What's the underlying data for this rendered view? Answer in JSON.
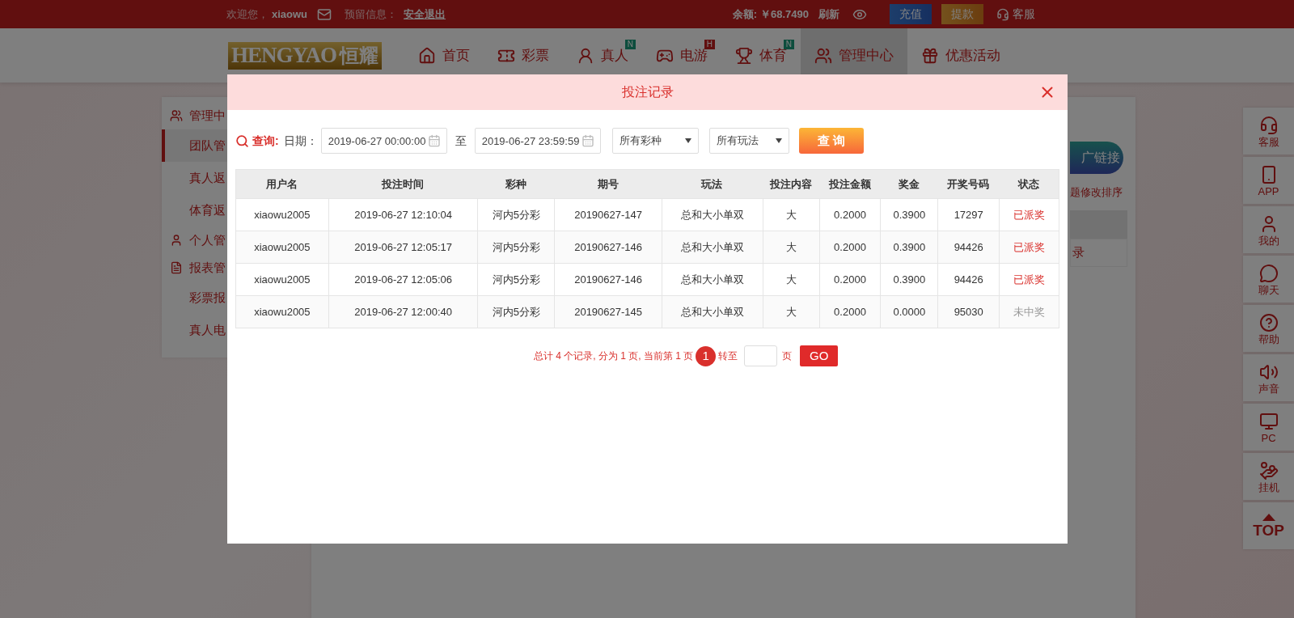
{
  "top_bar": {
    "welcome": "欢迎您，",
    "username": "xiaowu",
    "reserved_label": "预留信息：",
    "logout": "安全退出",
    "balance_label": "余额:",
    "balance": "￥68.7490",
    "refresh": "刷新",
    "deposit": "充值",
    "withdraw": "提款",
    "service": "客服"
  },
  "logo": {
    "latin": "HENGYAO",
    "chinese": "恒耀"
  },
  "nav": [
    {
      "label": "首页",
      "selected": false
    },
    {
      "label": "彩票",
      "selected": false
    },
    {
      "label": "真人",
      "badge": "N",
      "selected": false
    },
    {
      "label": "电游",
      "badge": "H",
      "selected": false
    },
    {
      "label": "体育",
      "badge": "N",
      "selected": false
    },
    {
      "label": "管理中心",
      "selected": true
    },
    {
      "label": "优惠活动",
      "selected": false
    }
  ],
  "sidebar": {
    "groups": [
      {
        "label": "管理中",
        "children": [
          {
            "label": "团队管",
            "selected": true
          },
          {
            "label": "真人返",
            "selected": false
          },
          {
            "label": "体育返",
            "selected": false
          }
        ]
      },
      {
        "label": "个人管"
      },
      {
        "label": "报表管",
        "children": [
          {
            "label": "彩票报",
            "selected": false
          },
          {
            "label": "真人电",
            "selected": false
          }
        ]
      }
    ]
  },
  "background_panel": {
    "link_button": "广链接",
    "sort_hint": "题修改排序",
    "row_text": "录"
  },
  "side_toolbar": [
    {
      "label": "客服"
    },
    {
      "label": "APP"
    },
    {
      "label": "我的"
    },
    {
      "label": "聊天"
    },
    {
      "label": "帮助"
    },
    {
      "label": "声音"
    },
    {
      "label": "PC"
    },
    {
      "label": "挂机"
    },
    {
      "label": "TOP"
    }
  ],
  "dialog": {
    "title": "投注记录",
    "filter": {
      "query_label": "查询:",
      "date_label": "日期：",
      "start": "2019-06-27 00:00:00",
      "to": "至",
      "end": "2019-06-27 23:59:59",
      "lottery_select": "所有彩种",
      "play_select": "所有玩法",
      "submit": "查 询"
    },
    "table": {
      "columns": [
        "用户名",
        "投注时间",
        "彩种",
        "期号",
        "玩法",
        "投注内容",
        "投注金额",
        "奖金",
        "开奖号码",
        "状态"
      ],
      "rows": [
        {
          "cells": [
            "xiaowu2005",
            "2019-06-27 12:10:04",
            "河内5分彩",
            "20190627-147",
            "总和大小单双",
            "大",
            "0.2000",
            "0.3900",
            "17297",
            "已派奖"
          ],
          "won": true
        },
        {
          "cells": [
            "xiaowu2005",
            "2019-06-27 12:05:17",
            "河内5分彩",
            "20190627-146",
            "总和大小单双",
            "大",
            "0.2000",
            "0.3900",
            "94426",
            "已派奖"
          ],
          "won": true
        },
        {
          "cells": [
            "xiaowu2005",
            "2019-06-27 12:05:06",
            "河内5分彩",
            "20190627-146",
            "总和大小单双",
            "大",
            "0.2000",
            "0.3900",
            "94426",
            "已派奖"
          ],
          "won": true
        },
        {
          "cells": [
            "xiaowu2005",
            "2019-06-27 12:00:40",
            "河内5分彩",
            "20190627-145",
            "总和大小单双",
            "大",
            "0.2000",
            "0.0000",
            "95030",
            "未中奖"
          ],
          "won": false
        }
      ]
    },
    "pagination": {
      "summary": "总计 4 个记录, 分为 1 页, 当前第 1 页",
      "pages": [
        {
          "label": "1",
          "selected": true
        }
      ],
      "goto_label": "转至",
      "page_unit": "页",
      "go": "GO"
    }
  }
}
